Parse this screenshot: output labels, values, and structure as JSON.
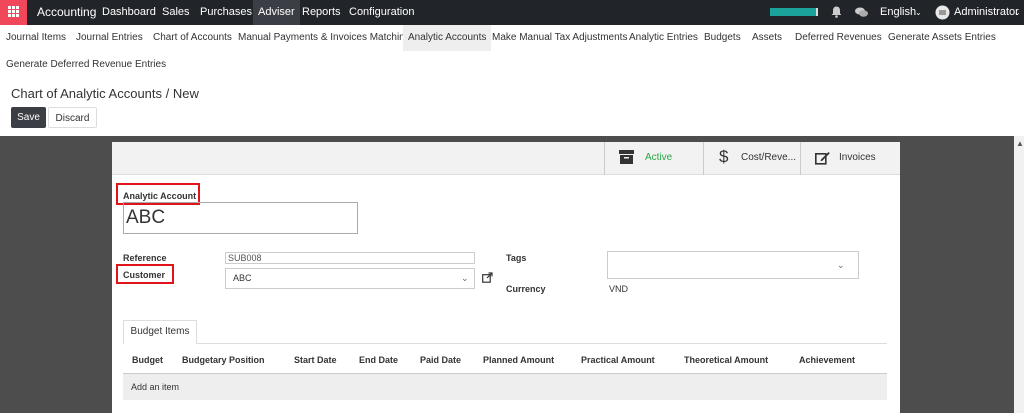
{
  "topbar": {
    "brand": "Accounting",
    "menu": [
      "Dashboard",
      "Sales",
      "Purchases",
      "Adviser",
      "Reports",
      "Configuration"
    ],
    "language": "English",
    "user": "Administrator",
    "progress_fraction": 0.95
  },
  "submenu": [
    "Journal Items",
    "Journal Entries",
    "Chart of Accounts",
    "Manual Payments & Invoices Matching",
    "Analytic Accounts",
    "Make Manual Tax Adjustments",
    "Analytic Entries",
    "Budgets",
    "Assets",
    "Deferred Revenues",
    "Generate Assets Entries",
    "Generate Deferred Revenue Entries"
  ],
  "breadcrumb": {
    "parent": "Chart of Analytic Accounts",
    "separator": "/",
    "current": "New"
  },
  "buttons": {
    "save": "Save",
    "discard": "Discard"
  },
  "smart_buttons": {
    "active": "Active",
    "cost_revenue": "Cost/Reve...",
    "invoices": "Invoices"
  },
  "form": {
    "analytic_account_label": "Analytic Account",
    "name_value": "ABC",
    "reference_label": "Reference",
    "reference_value": "SUB008",
    "customer_label": "Customer",
    "customer_value": "ABC",
    "tags_label": "Tags",
    "currency_label": "Currency",
    "currency_value": "VND"
  },
  "tabs": {
    "budget_items": "Budget Items"
  },
  "table": {
    "columns": [
      "Budget",
      "Budgetary Position",
      "Start Date",
      "End Date",
      "Paid Date",
      "Planned Amount",
      "Practical Amount",
      "Theoretical Amount",
      "Achievement"
    ],
    "add_item": "Add an item"
  },
  "colors": {
    "navbar": "#212529",
    "apps": "#f0475a",
    "highlight": "#e0151b",
    "active_green": "#28a745",
    "progress": "#1aa39b"
  }
}
